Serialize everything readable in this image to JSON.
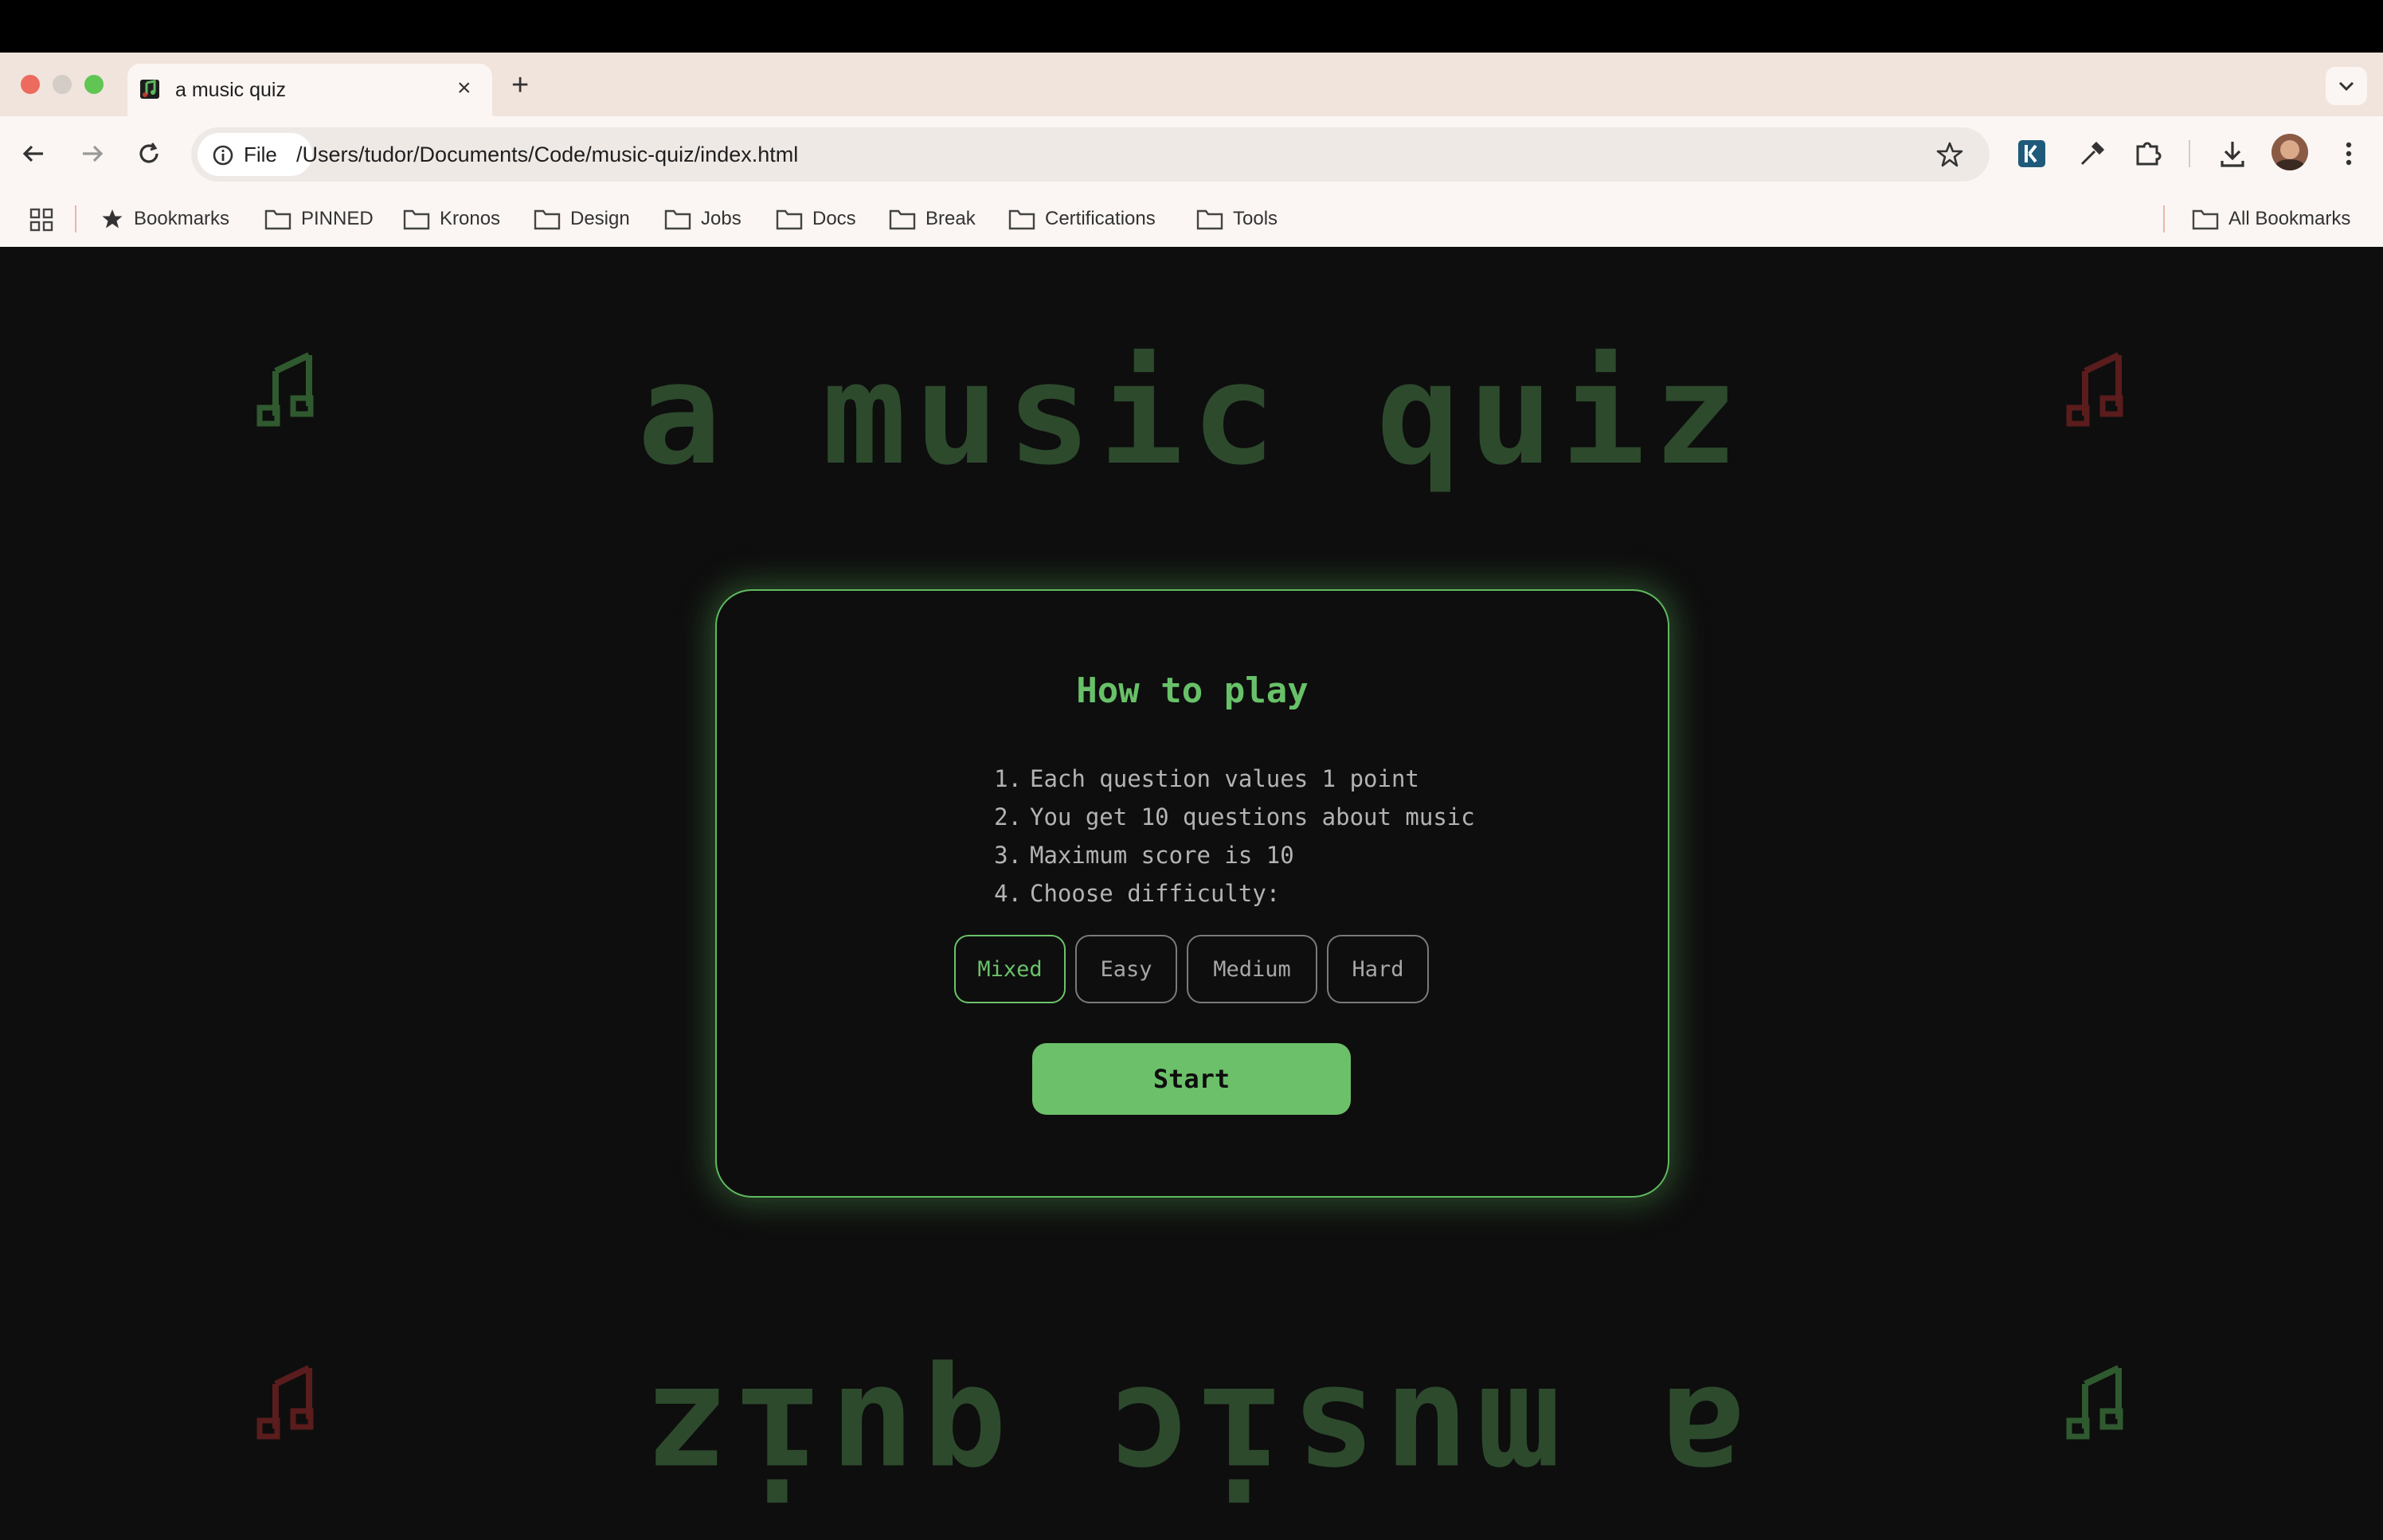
{
  "browser": {
    "tab_title": "a music quiz",
    "tab_close": "×",
    "new_tab": "+",
    "site_info_label": "File",
    "url": "/Users/tudor/Documents/Code/music-quiz/index.html",
    "bookmarks": [
      "Bookmarks",
      "PINNED",
      "Kronos",
      "Design",
      "Jobs",
      "Docs",
      "Break",
      "Certifications",
      "Tools"
    ],
    "all_bookmarks": "All Bookmarks"
  },
  "page": {
    "title": "a music quiz",
    "title_mirrored": "a music quiz",
    "card": {
      "heading": "How to play",
      "rules": [
        {
          "num": "1.",
          "text": "Each question values 1 point"
        },
        {
          "num": "2.",
          "text": "You get 10 questions about music"
        },
        {
          "num": "3.",
          "text": "Maximum score is 10"
        },
        {
          "num": "4.",
          "text": "Choose difficulty:"
        }
      ],
      "difficulties": [
        "Mixed",
        "Easy",
        "Medium",
        "Hard"
      ],
      "selected_difficulty": "Mixed",
      "start_label": "Start"
    }
  },
  "colors": {
    "accent_green": "#6cc06a",
    "title_green": "#2d4a2d",
    "note_green": "#2f5a2f",
    "note_red": "#5a1c1c"
  }
}
